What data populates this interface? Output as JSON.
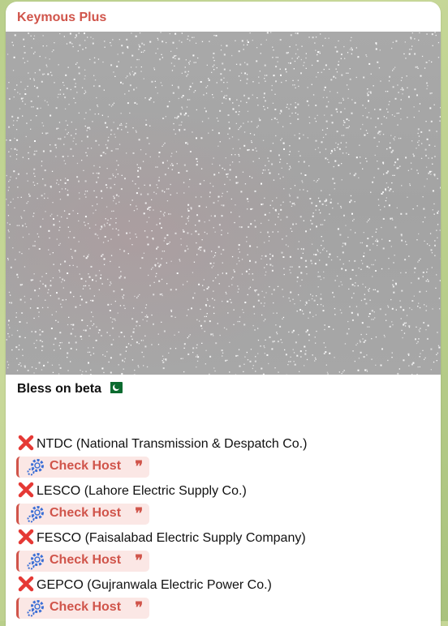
{
  "message": {
    "sender": "Keymous Plus",
    "caption_title": "Bless on beta",
    "flag_icon": "pakistan-flag-icon",
    "media_icon": "blurred-spoiler-image",
    "entries": [
      {
        "status_icon": "cross-mark-icon",
        "text": "NTDC (National Transmission & Despatch Co.)",
        "button_label": "Check Host"
      },
      {
        "status_icon": "cross-mark-icon",
        "text": "LESCO (Lahore Electric Supply Co.)",
        "button_label": "Check Host"
      },
      {
        "status_icon": "cross-mark-icon",
        "text": "FESCO (Faisalabad Electric Supply Company)",
        "button_label": "Check Host"
      },
      {
        "status_icon": "cross-mark-icon",
        "text": "GEPCO (Gujranwala Electric Power Co.)",
        "button_label": "Check Host"
      }
    ],
    "button_quote_glyph": "❞"
  },
  "colors": {
    "accent": "#d0544a",
    "button_bg": "#fbe7e5",
    "gear": "#3b6fd6",
    "cross": "#e53935",
    "background": "#b9cf8b"
  }
}
